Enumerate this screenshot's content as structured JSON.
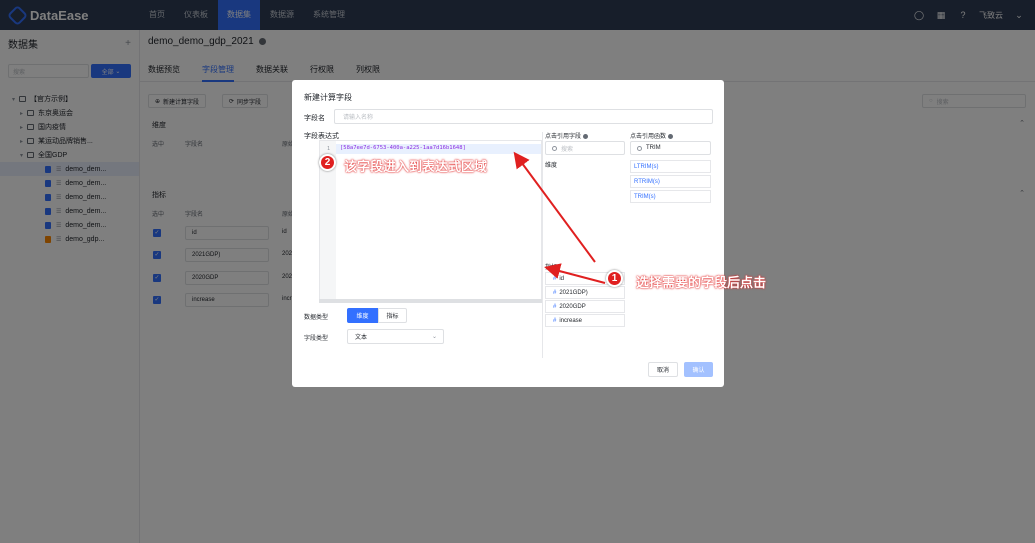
{
  "app": {
    "logo_text": "DataEase",
    "user_name": "飞致云"
  },
  "nav": {
    "items": [
      "首页",
      "仪表板",
      "数据集",
      "数据源",
      "系统管理"
    ],
    "active_index": 2
  },
  "sidebar": {
    "title": "数据集",
    "search_placeholder": "搜索",
    "filter_label": "全部",
    "tree": [
      {
        "label": "【官方示例】",
        "level": 0
      },
      {
        "label": "东京奥运会",
        "level": 1
      },
      {
        "label": "国内疫情",
        "level": 1
      },
      {
        "label": "某运动品牌销售...",
        "level": 1
      },
      {
        "label": "全国GDP",
        "level": 1
      },
      {
        "label": "demo_dem...",
        "level": 2
      },
      {
        "label": "demo_dem...",
        "level": 2
      },
      {
        "label": "demo_dem...",
        "level": 2
      },
      {
        "label": "demo_dem...",
        "level": 2
      },
      {
        "label": "demo_dem...",
        "level": 2
      },
      {
        "label": "demo_gdp...",
        "level": 2
      }
    ]
  },
  "main": {
    "title": "demo_demo_gdp_2021",
    "tabs": [
      "数据预览",
      "字段管理",
      "数据关联",
      "行权限",
      "列权限"
    ],
    "active_tab": 1,
    "btn_new_calc": "新建计算字段",
    "btn_sync": "同步字段",
    "search_placeholder": "搜索",
    "section_dimension": "维度",
    "section_measure": "指标",
    "col_selected": "选中",
    "col_field_name": "字段名",
    "col_origin": "原始",
    "measure_rows": [
      {
        "name": "id",
        "origin": "id"
      },
      {
        "name": "2021GDP)",
        "origin": "202"
      },
      {
        "name": "2020GDP",
        "origin": "202"
      },
      {
        "name": "increase",
        "origin": "incr"
      }
    ]
  },
  "dialog": {
    "title": "新建计算字段",
    "field_name_label": "字段名",
    "field_name_placeholder": "请输入名称",
    "expr_label": "字段表达式",
    "expr_line_no": "1",
    "expr_value": "[58a7ee7d-6753-400a-a225-1aa7d16b1648]",
    "ref_field_label": "点击引用字段",
    "ref_fn_label": "点击引用函数",
    "field_search_placeholder": "搜索",
    "fn_search_value": "TRIM",
    "dimension_label": "维度",
    "measure_label": "指标",
    "functions": [
      "LTRIM(s)",
      "RTRIM(s)",
      "TRIM(s)"
    ],
    "measures": [
      "id",
      "2021GDP)",
      "2020GDP",
      "increase"
    ],
    "data_type_label": "数据类型",
    "data_type_options": [
      "维度",
      "指标"
    ],
    "field_type_label": "字段类型",
    "field_type_value": "文本",
    "cancel_label": "取消",
    "ok_label": "确认"
  },
  "annotations": {
    "step1_num": "1",
    "step1_text": "选择需要的字段后点击",
    "step2_num": "2",
    "step2_text": "该字段进入到表达式区域",
    "color": "#e02020"
  }
}
